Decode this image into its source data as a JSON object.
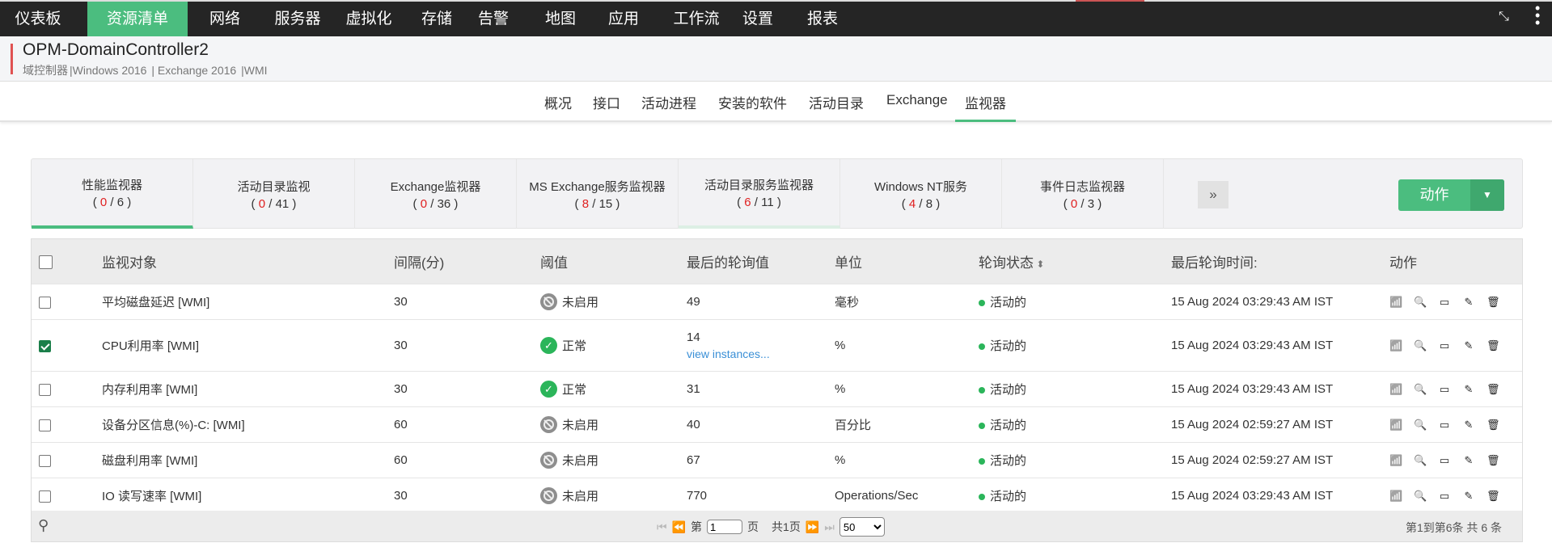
{
  "nav": {
    "items": [
      "仪表板",
      "资源清单",
      "网络",
      "服务器",
      "虚拟化",
      "存储",
      "告警",
      "地图",
      "应用",
      "工作流",
      "设置",
      "报表"
    ],
    "active": 1
  },
  "header": {
    "title": "OPM-DomainController2",
    "subtitle": [
      "域控制器",
      "Windows 2016",
      "Exchange 2016",
      "WMI"
    ]
  },
  "tabs": [
    "概况",
    "接口",
    "活动进程",
    "安装的软件",
    "活动目录",
    "Exchange",
    "监视器"
  ],
  "sub_tabs": [
    {
      "label": "性能监视器",
      "alerts": "0",
      "total": "6"
    },
    {
      "label": "活动目录监视",
      "alerts": "0",
      "total": "41"
    },
    {
      "label": "Exchange监视器",
      "alerts": "0",
      "total": "36"
    },
    {
      "label": "MS Exchange服务监视器",
      "alerts": "8",
      "total": "15"
    },
    {
      "label": "活动目录服务监视器",
      "alerts": "6",
      "total": "11"
    },
    {
      "label": "Windows NT服务",
      "alerts": "4",
      "total": "8"
    },
    {
      "label": "事件日志监视器",
      "alerts": "0",
      "total": "3"
    }
  ],
  "more_label": "»",
  "action_button": "动作",
  "table": {
    "headers": [
      "监视对象",
      "间隔(分)",
      "阈值",
      "最后的轮询值",
      "单位",
      "轮询状态",
      "最后轮询时间:",
      "动作"
    ],
    "rows": [
      {
        "checked": false,
        "name": "平均磁盘延迟 [WMI]",
        "interval": "30",
        "threshold": "未启用",
        "ok": false,
        "value": "49",
        "unit": "毫秒",
        "status": "活动的",
        "time": "15 Aug 2024 03:29:43 AM IST"
      },
      {
        "checked": true,
        "name": "CPU利用率 [WMI]",
        "interval": "30",
        "threshold": "正常",
        "ok": true,
        "value": "14",
        "link": "view instances...",
        "unit": "%",
        "status": "活动的",
        "time": "15 Aug 2024 03:29:43 AM IST"
      },
      {
        "checked": false,
        "name": "内存利用率 [WMI]",
        "interval": "30",
        "threshold": "正常",
        "ok": true,
        "value": "31",
        "unit": "%",
        "status": "活动的",
        "time": "15 Aug 2024 03:29:43 AM IST"
      },
      {
        "checked": false,
        "name": "设备分区信息(%)-C: [WMI]",
        "interval": "60",
        "threshold": "未启用",
        "ok": false,
        "value": "40",
        "unit": "百分比",
        "status": "活动的",
        "time": "15 Aug 2024 02:59:27 AM IST"
      },
      {
        "checked": false,
        "name": "磁盘利用率 [WMI]",
        "interval": "60",
        "threshold": "未启用",
        "ok": false,
        "value": "67",
        "unit": "%",
        "status": "活动的",
        "time": "15 Aug 2024 02:59:27 AM IST"
      },
      {
        "checked": false,
        "name": "IO 读写速率 [WMI]",
        "interval": "30",
        "threshold": "未启用",
        "ok": false,
        "value": "770",
        "unit": "Operations/Sec",
        "status": "活动的",
        "time": "15 Aug 2024 03:29:43 AM IST"
      }
    ]
  },
  "pagination": {
    "page_prefix": "第",
    "page": "1",
    "page_suffix": "页",
    "total_pages": "共1页",
    "page_size": "50",
    "info": "第1到第6条   共 6 条"
  },
  "colors": {
    "accent": "#4bbd7f",
    "alert": "#e02020",
    "nav_bg": "#252525"
  }
}
